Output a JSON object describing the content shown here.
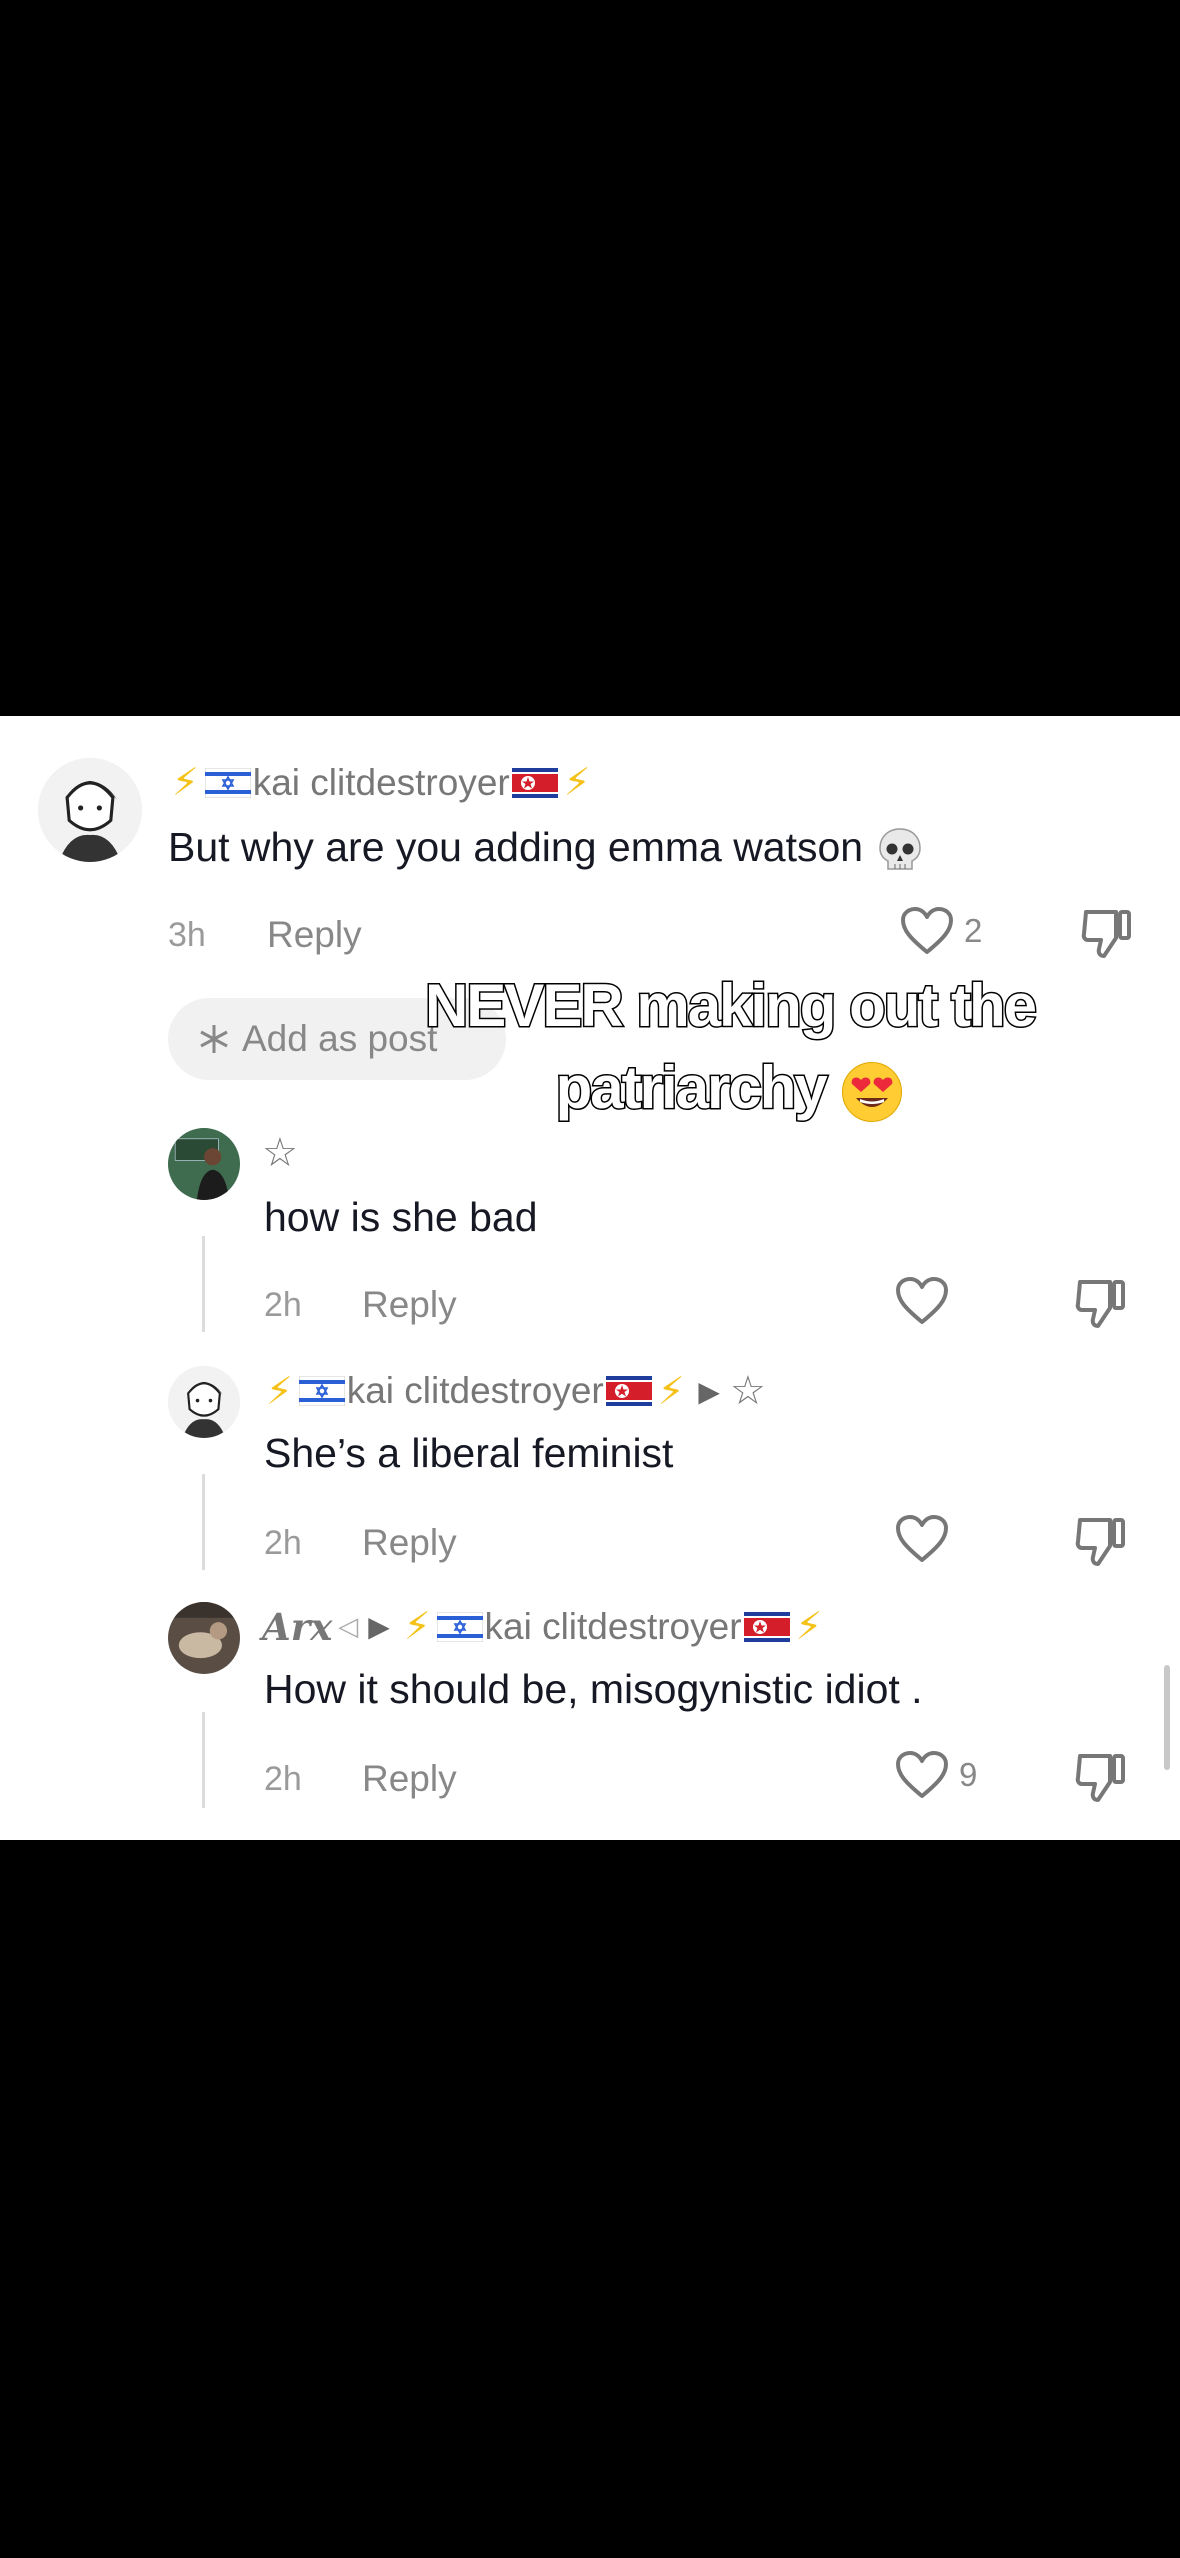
{
  "overlay_caption": {
    "line1": "NEVER making out the",
    "line2": "patriarchy"
  },
  "comments": [
    {
      "username": "kai clitdestroyer",
      "text": "But why are you adding emma watson",
      "time": "3h",
      "reply_label": "Reply",
      "likes": "2"
    },
    {
      "username": "☆",
      "text": "how is she bad",
      "time": "2h",
      "reply_label": "Reply",
      "likes": ""
    },
    {
      "username": "kai clitdestroyer",
      "reply_to": "☆",
      "text": "She’s a liberal feminist",
      "time": "2h",
      "reply_label": "Reply",
      "likes": ""
    },
    {
      "username": "Arx",
      "reply_to": "kai clitdestroyer",
      "text": "How it should be, misogynistic idiot .",
      "time": "2h",
      "reply_label": "Reply",
      "likes": "9"
    }
  ],
  "add_as_post_label": "Add as post",
  "colors": {
    "background": "#000000",
    "panel": "#ffffff",
    "bolt": "#f5c21a",
    "muted_text": "#888888",
    "body_text": "#161823"
  },
  "icons": [
    "lightning-icon",
    "israel-flag-icon",
    "north-korea-flag-icon",
    "heart-icon",
    "dislike-icon",
    "sparkle-icon",
    "star-icon",
    "play-arrow-icon",
    "skull-emoji",
    "heart-eyes-emoji"
  ]
}
